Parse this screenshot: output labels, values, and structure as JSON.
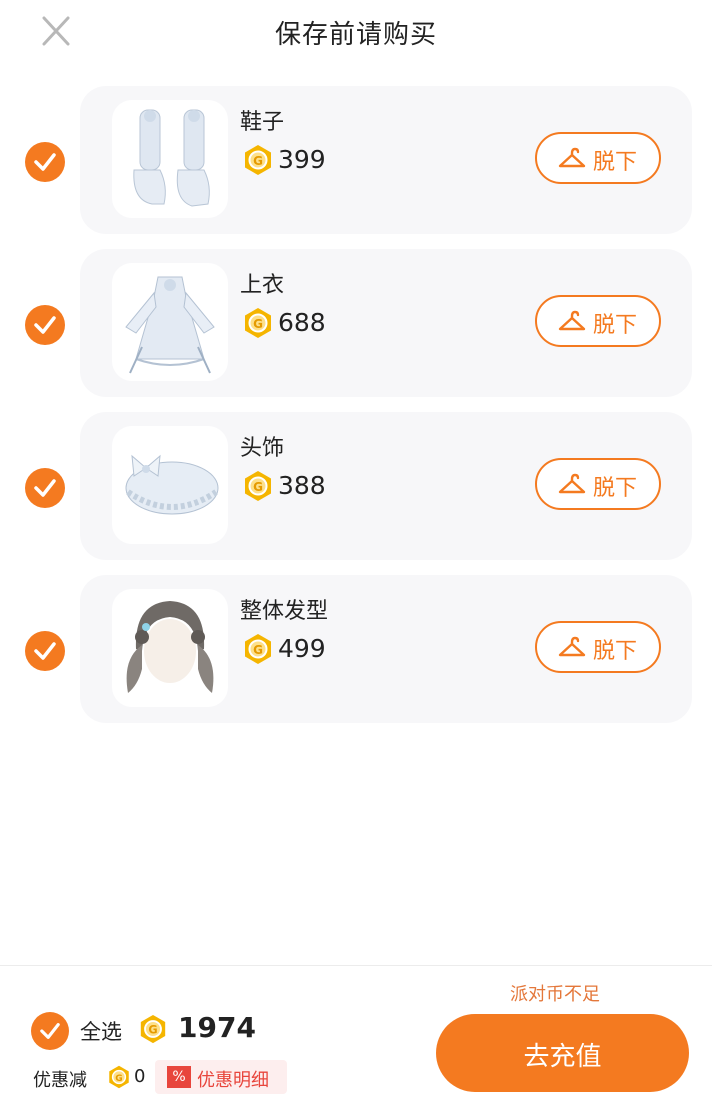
{
  "header": {
    "title": "保存前请购买",
    "close_icon": "close-icon"
  },
  "items": [
    {
      "name": "鞋子",
      "price": "399",
      "takeoff_label": "脱下",
      "checked": true,
      "image": "white-lolita-boots"
    },
    {
      "name": "上衣",
      "price": "688",
      "takeoff_label": "脱下",
      "checked": true,
      "image": "white-frilly-dress"
    },
    {
      "name": "头饰",
      "price": "388",
      "takeoff_label": "脱下",
      "checked": true,
      "image": "frilly-headband-bow"
    },
    {
      "name": "整体发型",
      "price": "499",
      "takeoff_label": "脱下",
      "checked": true,
      "image": "twin-tails-hairstyle"
    }
  ],
  "footer": {
    "select_all_label": "全选",
    "total": "1974",
    "discount_label": "优惠减",
    "discount_value": "0",
    "discount_badge": "%",
    "detail_label": "优惠明细",
    "insufficient": "派对币不足",
    "recharge_label": "去充值"
  },
  "colors": {
    "accent": "#f47a20",
    "card_bg": "#f7f7f9",
    "coin": "#f5b500",
    "discount_red": "#e8453c"
  }
}
